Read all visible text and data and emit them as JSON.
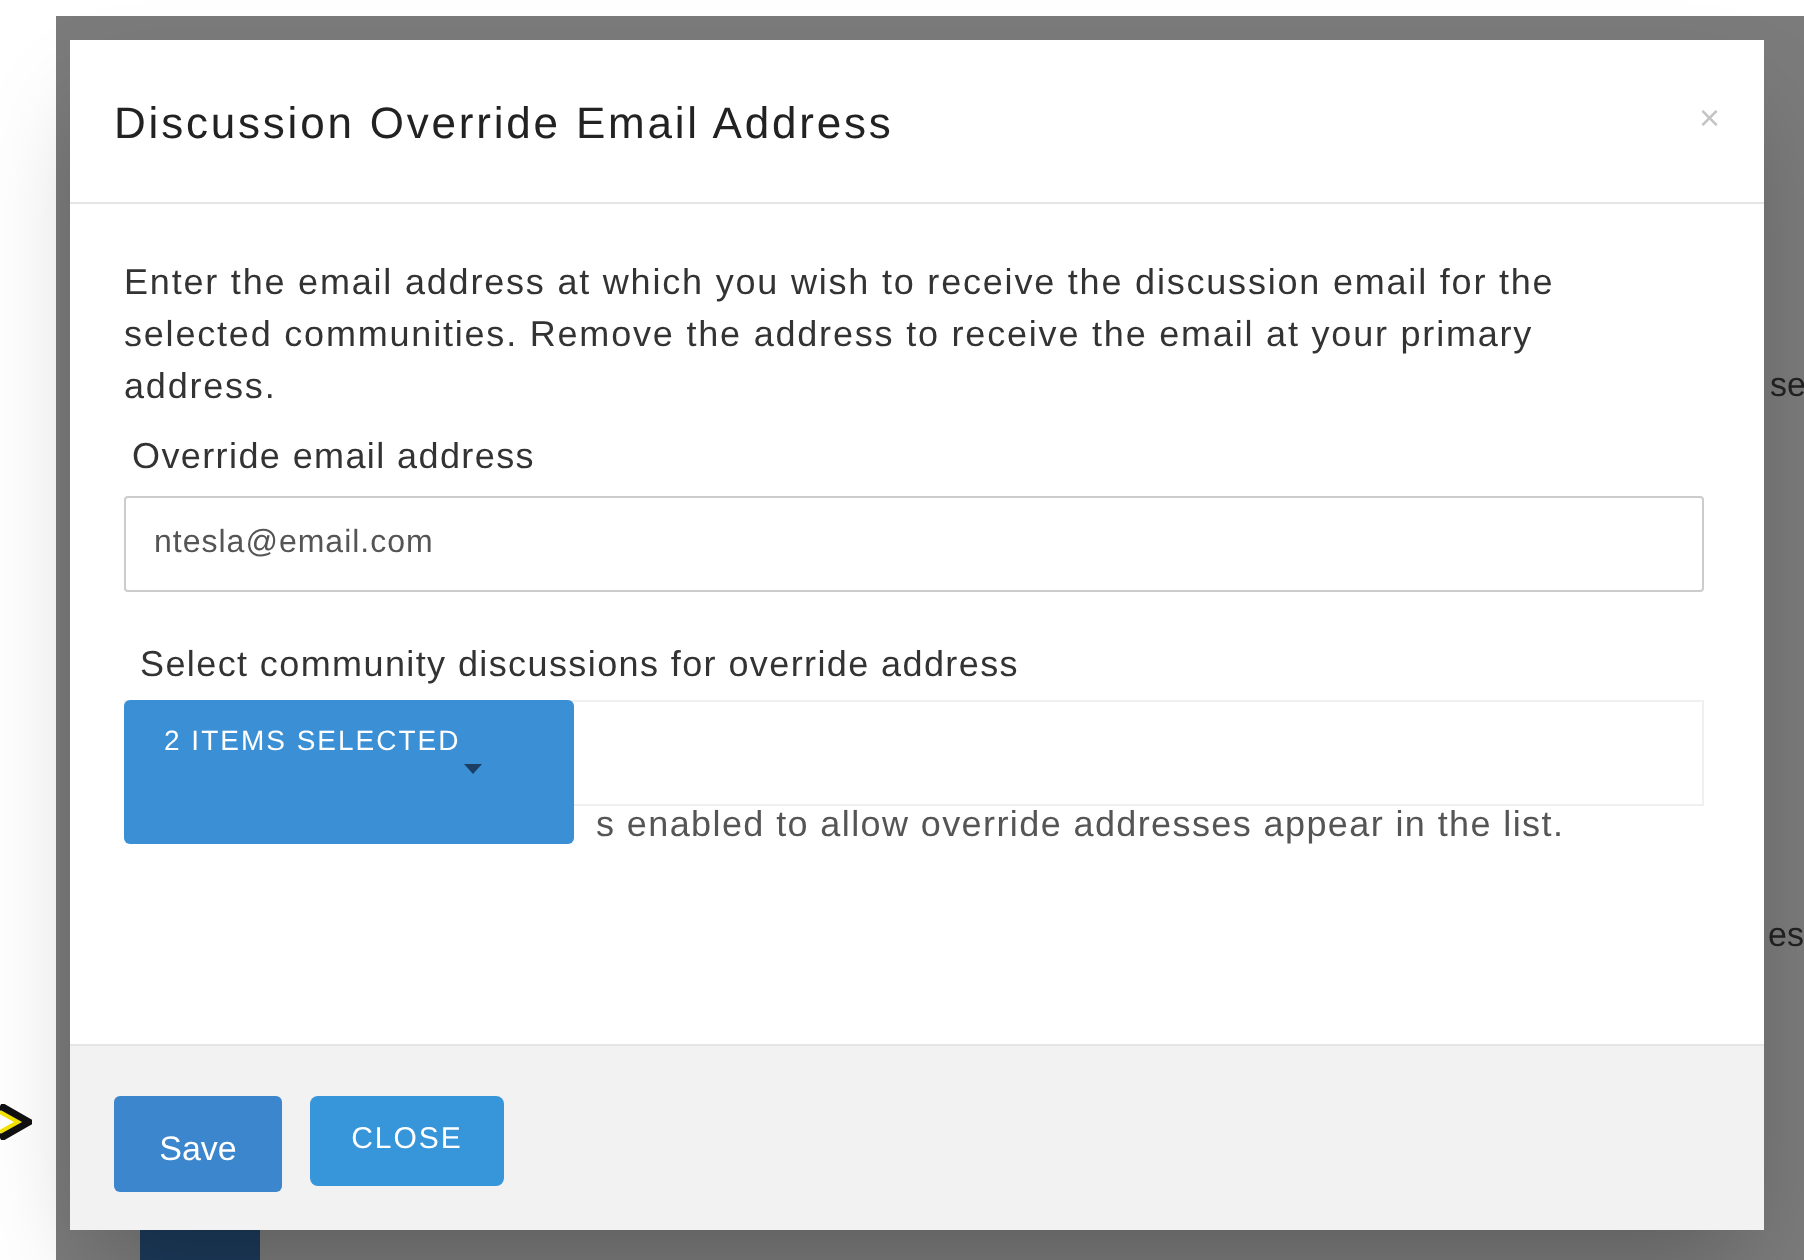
{
  "background": {
    "fragments": [
      "se",
      "es"
    ]
  },
  "modal": {
    "title": "Discussion Override Email Address",
    "close_glyph": "×",
    "intro": "Enter the email address at which you wish to receive the discussion email for the selected communities. Remove the address to receive the email at your primary address.",
    "email_label": "Override email address",
    "email_value": "ntesla@email.com",
    "select_label": "Select community discussions for override address",
    "select_button": "2 ITEMS SELECTED",
    "expanded": false,
    "hint": "s enabled to allow override addresses appear in the list.",
    "buttons": [
      {
        "kind": "primary",
        "label": "Save"
      },
      {
        "kind": "secondary",
        "label": "CLOSE"
      }
    ]
  }
}
